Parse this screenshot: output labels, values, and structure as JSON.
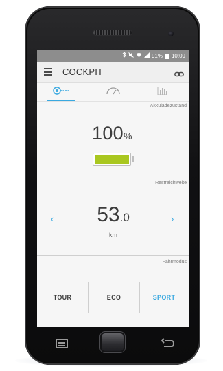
{
  "statusbar": {
    "battery_percent": "91%",
    "time": "10:09"
  },
  "appbar": {
    "title": "COCKPIT",
    "menu_icon": "hamburger-menu-icon",
    "link_icon": "link-chain-icon"
  },
  "tabs": [
    {
      "icon": "connection-toggle-icon",
      "active": true
    },
    {
      "icon": "speedometer-icon",
      "active": false
    },
    {
      "icon": "bar-chart-icon",
      "active": false
    }
  ],
  "battery_section": {
    "label": "Akkuladezustand",
    "value": "100",
    "unit": "%",
    "fill_fraction": 1.0
  },
  "range_section": {
    "label": "Restreichweite",
    "value_int": "53",
    "value_dec": ".0",
    "unit": "km",
    "prev_arrow": "‹",
    "next_arrow": "›"
  },
  "mode_section": {
    "label": "Fahrmodus",
    "modes": [
      {
        "label": "TOUR",
        "active": false
      },
      {
        "label": "ECO",
        "active": false
      },
      {
        "label": "SPORT",
        "active": true
      }
    ]
  },
  "colors": {
    "accent": "#3aa9e0",
    "battery_fill": "#a9c720",
    "statusbar": "#8d8d8d"
  }
}
